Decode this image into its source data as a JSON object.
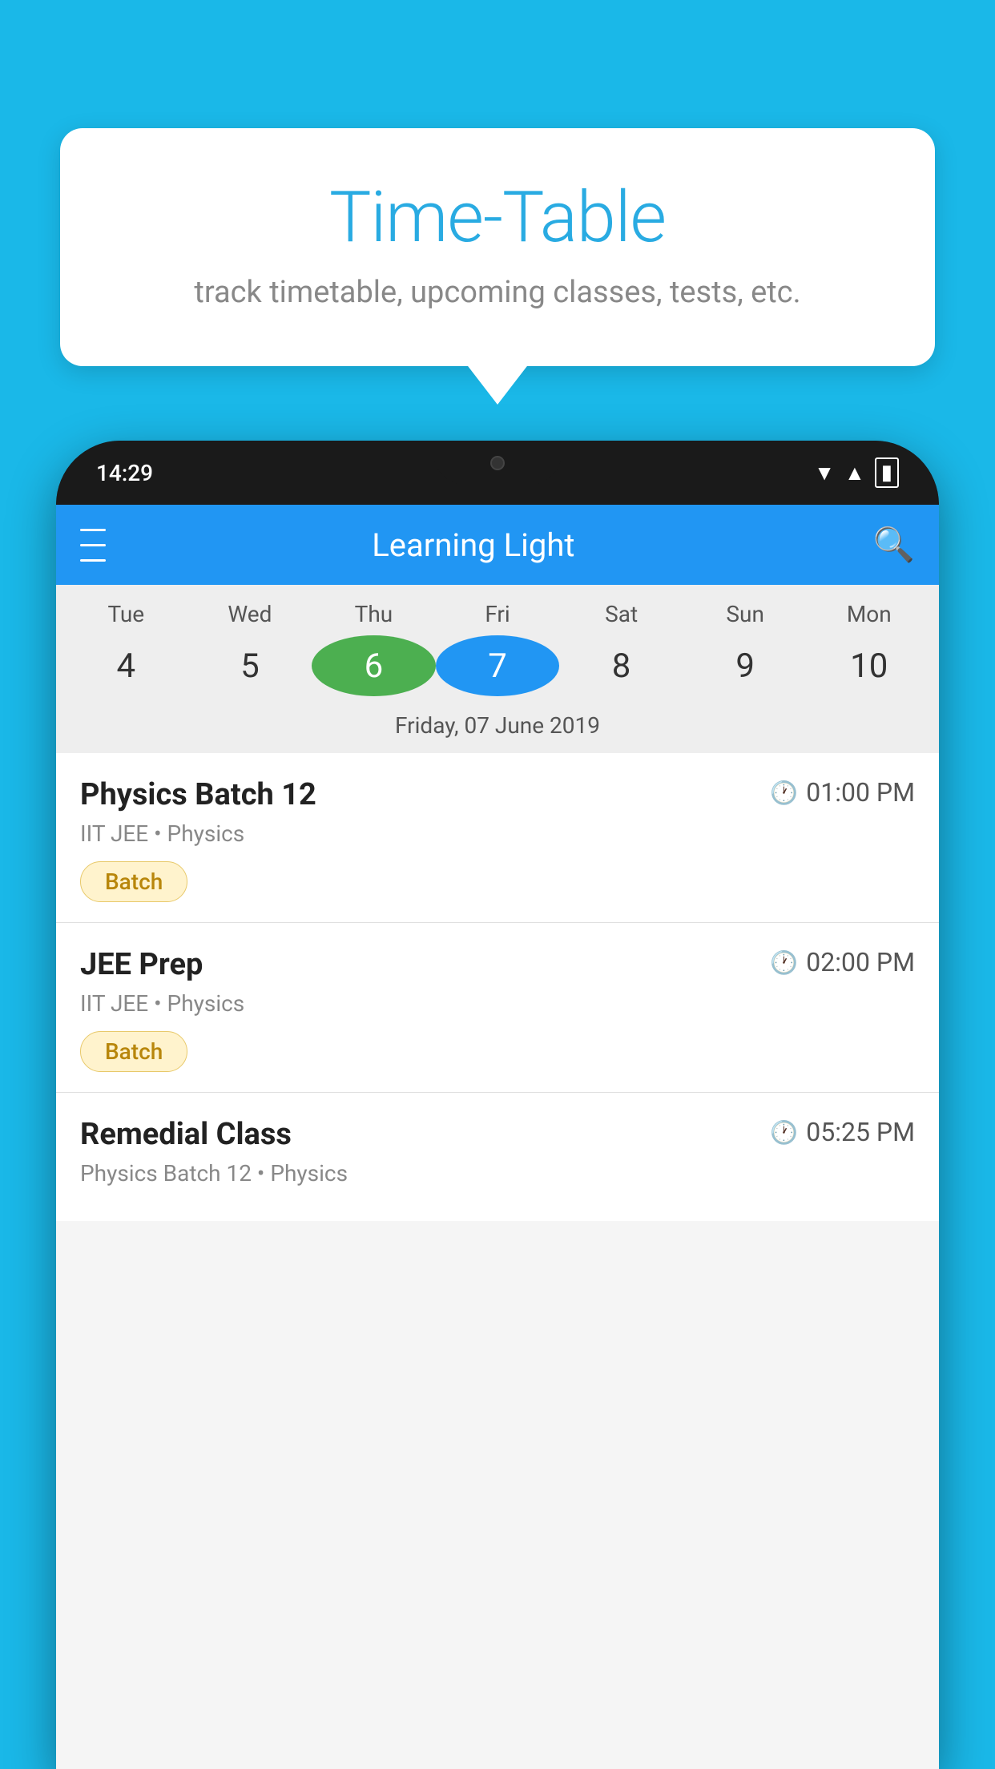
{
  "background_color": "#1ab8e8",
  "tooltip": {
    "title": "Time-Table",
    "subtitle": "track timetable, upcoming classes, tests, etc."
  },
  "phone": {
    "status_bar": {
      "time": "14:29"
    },
    "header": {
      "title": "Learning Light",
      "menu_label": "menu",
      "search_label": "search"
    },
    "calendar": {
      "days": [
        {
          "name": "Tue",
          "number": "4",
          "state": "normal"
        },
        {
          "name": "Wed",
          "number": "5",
          "state": "normal"
        },
        {
          "name": "Thu",
          "number": "6",
          "state": "today"
        },
        {
          "name": "Fri",
          "number": "7",
          "state": "selected"
        },
        {
          "name": "Sat",
          "number": "8",
          "state": "normal"
        },
        {
          "name": "Sun",
          "number": "9",
          "state": "normal"
        },
        {
          "name": "Mon",
          "number": "10",
          "state": "normal"
        }
      ],
      "selected_date_label": "Friday, 07 June 2019"
    },
    "classes": [
      {
        "name": "Physics Batch 12",
        "time": "01:00 PM",
        "meta": "IIT JEE • Physics",
        "badge": "Batch"
      },
      {
        "name": "JEE Prep",
        "time": "02:00 PM",
        "meta": "IIT JEE • Physics",
        "badge": "Batch"
      },
      {
        "name": "Remedial Class",
        "time": "05:25 PM",
        "meta": "Physics Batch 12 • Physics",
        "badge": null
      }
    ]
  }
}
